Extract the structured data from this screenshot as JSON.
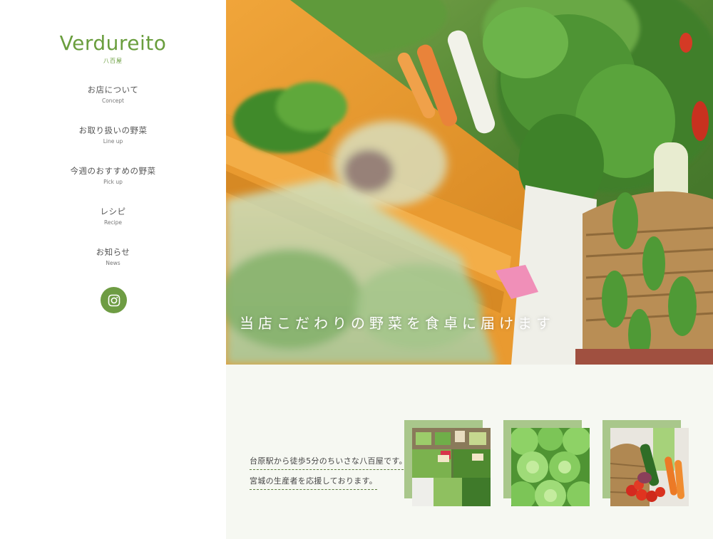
{
  "brand": {
    "logo": "Verdureito",
    "logo_sub": "八百屋"
  },
  "nav": {
    "items": [
      {
        "jp": "お店について",
        "en": "Concept"
      },
      {
        "jp": "お取り扱いの野菜",
        "en": "Line up"
      },
      {
        "jp": "今週のおすすめの野菜",
        "en": "Pick up"
      },
      {
        "jp": "レシピ",
        "en": "Recipe"
      },
      {
        "jp": "お知らせ",
        "en": "News"
      }
    ],
    "social_icon": "instagram-icon"
  },
  "hero": {
    "tagline": "当店こだわりの野菜を食卓に届けます"
  },
  "intro": {
    "line1": "台原駅から徒歩5分のちいさな八百屋です。",
    "line2": "宮城の生産者を応援しております。"
  },
  "colors": {
    "accent": "#6a9e3e",
    "thumb_frame": "#a9c78b",
    "lower_bg": "#f6f8f2"
  }
}
